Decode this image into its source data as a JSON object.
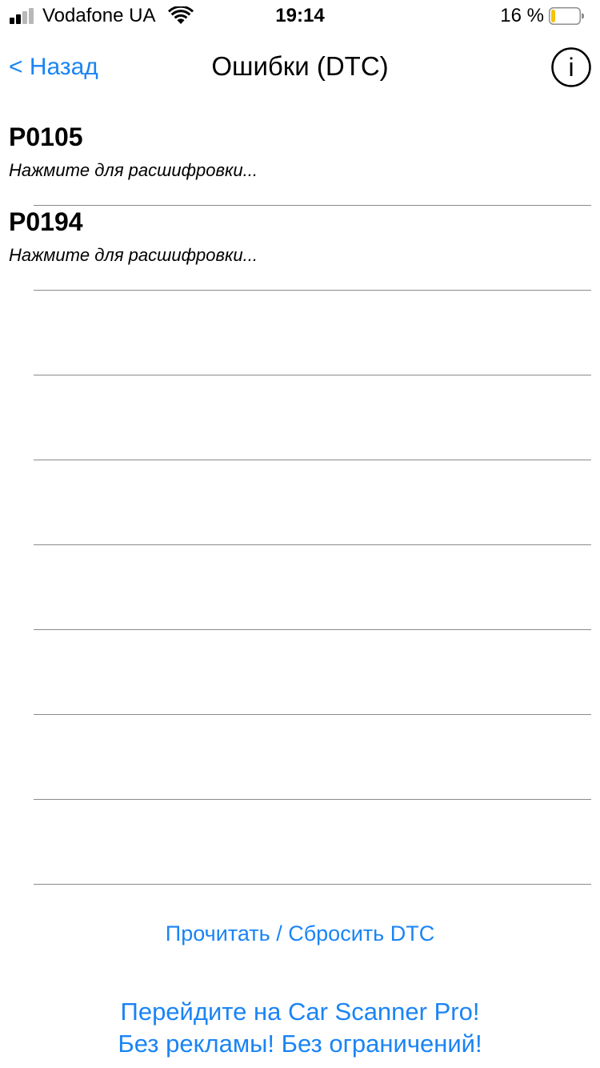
{
  "status_bar": {
    "carrier": "Vodafone UA",
    "time": "19:14",
    "battery_percent": "16 %",
    "battery_level": 0.16,
    "signal_bars": 2,
    "icons": [
      "signal-icon",
      "wifi-icon",
      "battery-icon"
    ],
    "colors": {
      "battery_fill": "#f5c400",
      "signal_inactive": "#b8b8b8"
    }
  },
  "nav": {
    "back_label": "< Назад",
    "title": "Ошибки (DTC)",
    "info_icon": "info-icon",
    "info_glyph": "i"
  },
  "dtc_list": [
    {
      "code": "P0105",
      "hint": "Нажмите для расшифровки..."
    },
    {
      "code": "P0194",
      "hint": "Нажмите для расшифровки..."
    },
    {
      "code": "",
      "hint": ""
    },
    {
      "code": "",
      "hint": ""
    },
    {
      "code": "",
      "hint": ""
    },
    {
      "code": "",
      "hint": ""
    },
    {
      "code": "",
      "hint": ""
    },
    {
      "code": "",
      "hint": ""
    },
    {
      "code": "",
      "hint": ""
    }
  ],
  "actions": {
    "read_reset_label": "Прочитать / Сбросить DTC",
    "promo_line1": "Перейдите на Car Scanner Pro!",
    "promo_line2": "Без рекламы! Без ограничений!"
  },
  "colors": {
    "accent": "#1a84f5",
    "separator": "#8a8a8a"
  }
}
